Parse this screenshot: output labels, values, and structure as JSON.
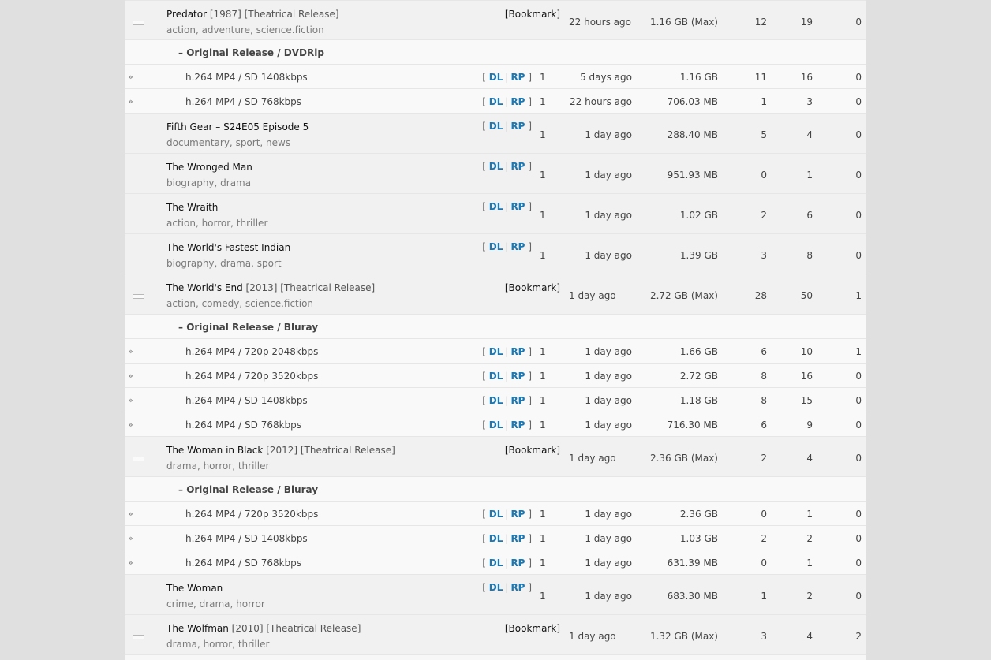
{
  "labels": {
    "bookmark": "[Bookmark]",
    "dl": "DL",
    "rp": "RP",
    "bracket_open": "[",
    "bracket_close": "]",
    "pipe": "|",
    "expand_glyph": "»",
    "collapse_glyph": "–"
  },
  "colors": {
    "link": "#1a78b5",
    "page_bg": "#e0e0e0",
    "panel_bg": "#f7f7f7"
  },
  "rows": [
    {
      "type": "group",
      "title": "Predator",
      "meta": " [1987] [Theatrical Release]",
      "tags": "action, adventure, science.fiction",
      "kind": "bookmark",
      "age": "22 hours ago",
      "size": "1.16 GB (Max)",
      "c1": "12",
      "c2": "19",
      "c3": "0"
    },
    {
      "type": "sub",
      "title": "Original Release / DVDRip"
    },
    {
      "type": "file",
      "name": "h.264 MP4 / SD 1408kbps",
      "num": "1",
      "age": "5 days ago",
      "size": "1.16 GB",
      "c1": "11",
      "c2": "16",
      "c3": "0"
    },
    {
      "type": "file",
      "name": "h.264 MP4 / SD 768kbps",
      "num": "1",
      "age": "22 hours ago",
      "size": "706.03 MB",
      "c1": "1",
      "c2": "3",
      "c3": "0"
    },
    {
      "type": "group",
      "title": "Fifth Gear – S24E05 Episode 5",
      "meta": "",
      "tags": "documentary, sport, news",
      "kind": "links",
      "num": "1",
      "age": "1 day ago",
      "size": "288.40 MB",
      "c1": "5",
      "c2": "4",
      "c3": "0"
    },
    {
      "type": "group",
      "title": "The Wronged Man",
      "meta": "",
      "tags": "biography, drama",
      "kind": "links",
      "num": "1",
      "age": "1 day ago",
      "size": "951.93 MB",
      "c1": "0",
      "c2": "1",
      "c3": "0"
    },
    {
      "type": "group",
      "title": "The Wraith",
      "meta": "",
      "tags": "action, horror, thriller",
      "kind": "links",
      "num": "1",
      "age": "1 day ago",
      "size": "1.02 GB",
      "c1": "2",
      "c2": "6",
      "c3": "0"
    },
    {
      "type": "group",
      "title": "The World's Fastest Indian",
      "meta": "",
      "tags": "biography, drama, sport",
      "kind": "links",
      "num": "1",
      "age": "1 day ago",
      "size": "1.39 GB",
      "c1": "3",
      "c2": "8",
      "c3": "0"
    },
    {
      "type": "group",
      "title": "The World's End",
      "meta": " [2013] [Theatrical Release]",
      "tags": "action, comedy, science.fiction",
      "kind": "bookmark",
      "age": "1 day ago",
      "size": "2.72 GB (Max)",
      "c1": "28",
      "c2": "50",
      "c3": "1"
    },
    {
      "type": "sub",
      "title": "Original Release / Bluray"
    },
    {
      "type": "file",
      "name": "h.264 MP4 / 720p 2048kbps",
      "num": "1",
      "age": "1 day ago",
      "size": "1.66 GB",
      "c1": "6",
      "c2": "10",
      "c3": "1"
    },
    {
      "type": "file",
      "name": "h.264 MP4 / 720p 3520kbps",
      "num": "1",
      "age": "1 day ago",
      "size": "2.72 GB",
      "c1": "8",
      "c2": "16",
      "c3": "0"
    },
    {
      "type": "file",
      "name": "h.264 MP4 / SD 1408kbps",
      "num": "1",
      "age": "1 day ago",
      "size": "1.18 GB",
      "c1": "8",
      "c2": "15",
      "c3": "0"
    },
    {
      "type": "file",
      "name": "h.264 MP4 / SD 768kbps",
      "num": "1",
      "age": "1 day ago",
      "size": "716.30 MB",
      "c1": "6",
      "c2": "9",
      "c3": "0"
    },
    {
      "type": "group",
      "title": "The Woman in Black",
      "meta": " [2012] [Theatrical Release]",
      "tags": "drama, horror, thriller",
      "kind": "bookmark",
      "age": "1 day ago",
      "size": "2.36 GB (Max)",
      "c1": "2",
      "c2": "4",
      "c3": "0"
    },
    {
      "type": "sub",
      "title": "Original Release / Bluray"
    },
    {
      "type": "file",
      "name": "h.264 MP4 / 720p 3520kbps",
      "num": "1",
      "age": "1 day ago",
      "size": "2.36 GB",
      "c1": "0",
      "c2": "1",
      "c3": "0"
    },
    {
      "type": "file",
      "name": "h.264 MP4 / SD 1408kbps",
      "num": "1",
      "age": "1 day ago",
      "size": "1.03 GB",
      "c1": "2",
      "c2": "2",
      "c3": "0"
    },
    {
      "type": "file",
      "name": "h.264 MP4 / SD 768kbps",
      "num": "1",
      "age": "1 day ago",
      "size": "631.39 MB",
      "c1": "0",
      "c2": "1",
      "c3": "0"
    },
    {
      "type": "group",
      "title": "The Woman",
      "meta": "",
      "tags": "crime, drama, horror",
      "kind": "links",
      "num": "1",
      "age": "1 day ago",
      "size": "683.30 MB",
      "c1": "1",
      "c2": "2",
      "c3": "0"
    },
    {
      "type": "group",
      "title": "The Wolfman",
      "meta": " [2010] [Theatrical Release]",
      "tags": "drama, horror, thriller",
      "kind": "bookmark",
      "age": "1 day ago",
      "size": "1.32 GB (Max)",
      "c1": "3",
      "c2": "4",
      "c3": "2"
    }
  ]
}
